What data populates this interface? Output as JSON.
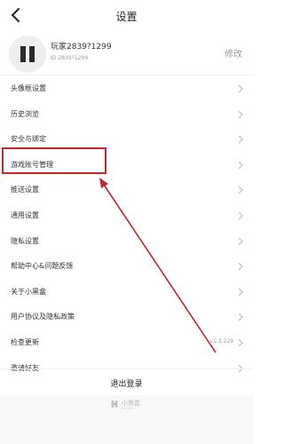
{
  "header": {
    "title": "设置"
  },
  "profile": {
    "name": "玩家2839?1299",
    "id": "ID:2839?1299",
    "edit_label": "修改"
  },
  "menu": {
    "items": [
      {
        "label": "头像框设置",
        "value": ""
      },
      {
        "label": "历史浏览",
        "value": ""
      },
      {
        "label": "安全与绑定",
        "value": ""
      },
      {
        "label": "游戏账号管理",
        "value": ""
      },
      {
        "label": "推送设置",
        "value": ""
      },
      {
        "label": "通用设置",
        "value": ""
      },
      {
        "label": "隐私设置",
        "value": ""
      },
      {
        "label": "帮助中心&问题反馈",
        "value": ""
      },
      {
        "label": "关于小黑盒",
        "value": ""
      },
      {
        "label": "用户协议及隐私政策",
        "value": ""
      },
      {
        "label": "检查更新",
        "value": "v1.3.229"
      },
      {
        "label": "邀请好友",
        "value": ""
      }
    ]
  },
  "logout": {
    "label": "退出登录"
  },
  "footer": {
    "brand": "小黑盒",
    "tagline": "HEYBOX"
  },
  "colors": {
    "annotation": "#c0282b",
    "text": "#222222",
    "muted": "#999999"
  }
}
